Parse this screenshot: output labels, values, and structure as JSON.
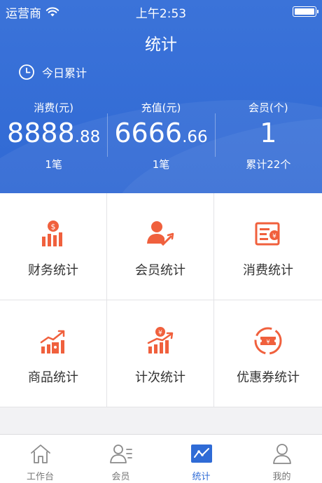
{
  "status_bar": {
    "carrier": "运营商",
    "time": "上午2:53"
  },
  "header": {
    "title": "统计",
    "today_label": "今日累计"
  },
  "stats": [
    {
      "label": "消费(元)",
      "value_int": "8888",
      "value_dec": ".88",
      "sub": "1笔"
    },
    {
      "label": "充值(元)",
      "value_int": "6666",
      "value_dec": ".66",
      "sub": "1笔"
    },
    {
      "label": "会员(个)",
      "value_int": "1",
      "value_dec": "",
      "sub": "累计22个"
    }
  ],
  "menu": [
    {
      "label": "财务统计",
      "icon": "finance-chart-icon"
    },
    {
      "label": "会员统计",
      "icon": "member-check-icon"
    },
    {
      "label": "消费统计",
      "icon": "consumption-card-icon"
    },
    {
      "label": "商品统计",
      "icon": "product-trend-icon"
    },
    {
      "label": "计次统计",
      "icon": "count-trend-icon"
    },
    {
      "label": "优惠券统计",
      "icon": "coupon-icon"
    }
  ],
  "tabbar": [
    {
      "label": "工作台",
      "icon": "home-icon",
      "active": false
    },
    {
      "label": "会员",
      "icon": "members-icon",
      "active": false
    },
    {
      "label": "统计",
      "icon": "statistics-icon",
      "active": true
    },
    {
      "label": "我的",
      "icon": "profile-icon",
      "active": false
    }
  ],
  "colors": {
    "header_blue": "#3069d4",
    "accent_orange": "#f0603d",
    "tab_active": "#2f6bd6",
    "tab_inactive": "#8a8a8a"
  }
}
